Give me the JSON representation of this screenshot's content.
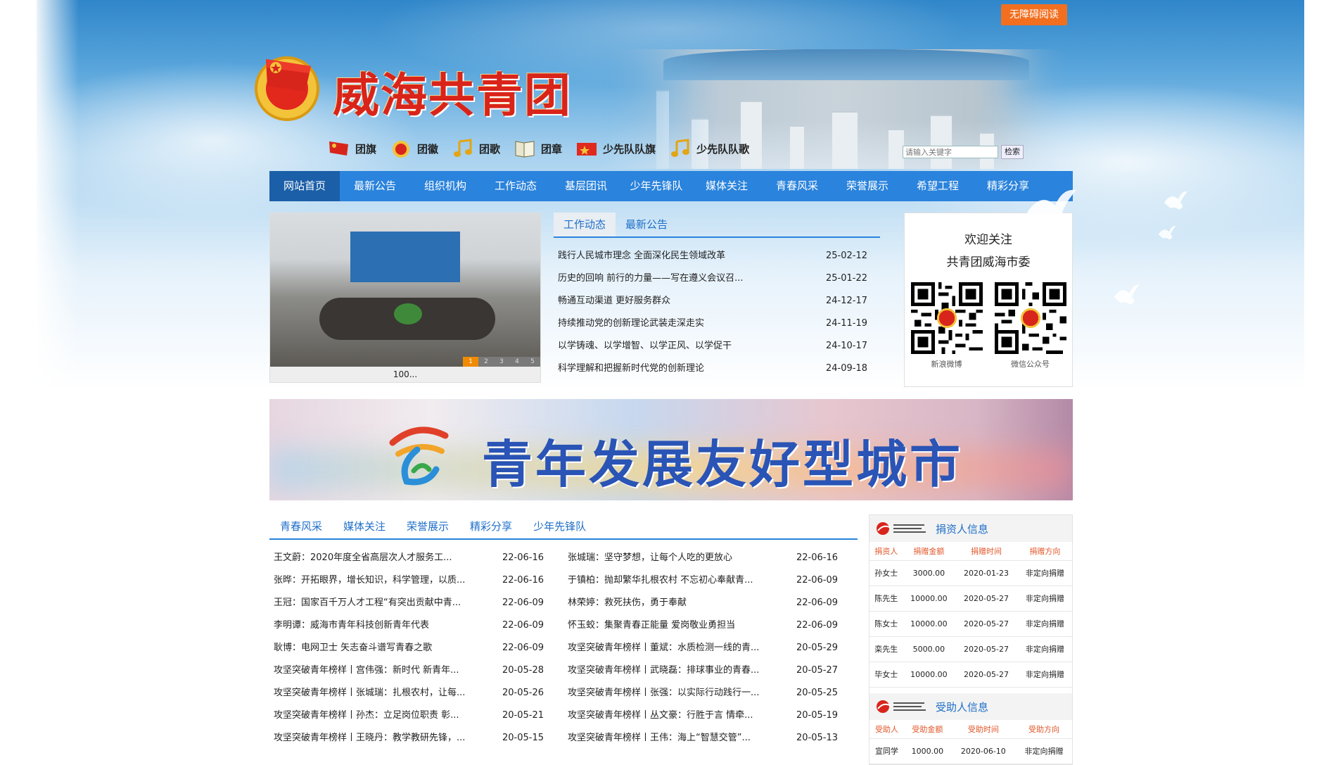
{
  "header": {
    "accessibility_label": "无障碍阅读",
    "site_title": "威海共青团",
    "icon_links": [
      {
        "label": "团旗",
        "icon": "red-flag-icon"
      },
      {
        "label": "团徽",
        "icon": "league-emblem-icon"
      },
      {
        "label": "团歌",
        "icon": "music-note-icon"
      },
      {
        "label": "团章",
        "icon": "book-icon"
      },
      {
        "label": "少先队队旗",
        "icon": "red-flag-icon"
      },
      {
        "label": "少先队队歌",
        "icon": "music-note-icon"
      }
    ],
    "search": {
      "placeholder": "请输入关键字",
      "button_label": "检索"
    }
  },
  "nav": {
    "items": [
      "网站首页",
      "最新公告",
      "组织机构",
      "工作动态",
      "基层团讯",
      "少年先锋队",
      "媒体关注",
      "青春风采",
      "荣誉展示",
      "希望工程",
      "精彩分享"
    ],
    "active_index": 0
  },
  "slider": {
    "caption": "100...",
    "dots": [
      "1",
      "2",
      "3",
      "4",
      "5"
    ],
    "active_dot": 0
  },
  "news": {
    "tabs": [
      "工作动态",
      "最新公告"
    ],
    "active_tab": 0,
    "items": [
      {
        "title": "践行人民城市理念 全面深化民生领域改革",
        "date": "25-02-12"
      },
      {
        "title": "历史的回响 前行的力量——写在遵义会议召...",
        "date": "25-01-22"
      },
      {
        "title": "畅通互动渠道 更好服务群众",
        "date": "24-12-17"
      },
      {
        "title": "持续推动党的创新理论武装走深走实",
        "date": "24-11-19"
      },
      {
        "title": "以学铸魂、以学增智、以学正风、以学促干",
        "date": "24-10-17"
      },
      {
        "title": "科学理解和把握新时代党的创新理论",
        "date": "24-09-18"
      }
    ]
  },
  "follow": {
    "line1": "欢迎关注",
    "line2": "共青团威海市委",
    "qr_codes": [
      {
        "label": "新浪微博"
      },
      {
        "label": "微信公众号"
      }
    ]
  },
  "banner": {
    "text": "青年发展友好型城市"
  },
  "feature": {
    "tabs": [
      "青春风采",
      "媒体关注",
      "荣誉展示",
      "精彩分享",
      "少年先锋队"
    ],
    "active_tab": 0,
    "rows": [
      [
        {
          "title": "王文蔚：2020年度全省高层次人才服务工...",
          "date": "22-06-16"
        },
        {
          "title": "张城瑞：坚守梦想，让每个人吃的更放心",
          "date": "22-06-16"
        }
      ],
      [
        {
          "title": "张晔：开拓眼界，增长知识，科学管理，以质...",
          "date": "22-06-16"
        },
        {
          "title": "于镇柏：抛却繁华扎根农村 不忘初心奉献青...",
          "date": "22-06-09"
        }
      ],
      [
        {
          "title": "王冠：国家百千万人才工程“有突出贡献中青...",
          "date": "22-06-09"
        },
        {
          "title": "林荣婷：救死扶伤，勇于奉献",
          "date": "22-06-09"
        }
      ],
      [
        {
          "title": "李明谭：威海市青年科技创新青年代表",
          "date": "22-06-09"
        },
        {
          "title": "怀玉蛟：集聚青春正能量 爱岗敬业勇担当",
          "date": "22-06-09"
        }
      ],
      [
        {
          "title": "耿博：电网卫士 矢志奋斗谱写青春之歌",
          "date": "22-06-09"
        },
        {
          "title": "攻坚突破青年榜样丨董斌：水质检测一线的青...",
          "date": "20-05-29"
        }
      ],
      [
        {
          "title": "攻坚突破青年榜样丨宫伟强：新时代 新青年...",
          "date": "20-05-28"
        },
        {
          "title": "攻坚突破青年榜样丨武晓磊：排球事业的青春...",
          "date": "20-05-27"
        }
      ],
      [
        {
          "title": "攻坚突破青年榜样丨张城瑞：扎根农村，让每...",
          "date": "20-05-26"
        },
        {
          "title": "攻坚突破青年榜样丨张强：以实际行动践行一...",
          "date": "20-05-25"
        }
      ],
      [
        {
          "title": "攻坚突破青年榜样丨孙杰：立足岗位职责 彰...",
          "date": "20-05-21"
        },
        {
          "title": "攻坚突破青年榜样丨丛文豪：行胜于言 情牵...",
          "date": "20-05-19"
        }
      ],
      [
        {
          "title": "攻坚突破青年榜样丨王晓丹：教学教研先锋，...",
          "date": "20-05-15"
        },
        {
          "title": "攻坚突破青年榜样丨王伟：海上“智慧交管”...",
          "date": "20-05-13"
        }
      ]
    ]
  },
  "donors": {
    "title": "捐资人信息",
    "headers": [
      "捐资人",
      "捐赠金额",
      "捐赠时间",
      "捐赠方向"
    ],
    "rows": [
      [
        "孙女士",
        "3000.00",
        "2020-01-23",
        "非定向捐赠"
      ],
      [
        "陈先生",
        "10000.00",
        "2020-05-27",
        "非定向捐赠"
      ],
      [
        "陈女士",
        "10000.00",
        "2020-05-27",
        "非定向捐赠"
      ],
      [
        "栾先生",
        "5000.00",
        "2020-05-27",
        "非定向捐赠"
      ],
      [
        "毕女士",
        "10000.00",
        "2020-05-27",
        "非定向捐赠"
      ]
    ]
  },
  "aid": {
    "title": "受助人信息",
    "headers": [
      "受助人",
      "受助金额",
      "受助时间",
      "受助方向"
    ],
    "rows": [
      [
        "宣同学",
        "1000.00",
        "2020-06-10",
        "非定向捐赠"
      ]
    ]
  },
  "colors": {
    "nav_blue": "#2a83dc",
    "nav_active": "#1b5fa8",
    "accent_orange": "#f26f1f",
    "title_red": "#d9241a",
    "link_blue": "#1f6fc8"
  }
}
